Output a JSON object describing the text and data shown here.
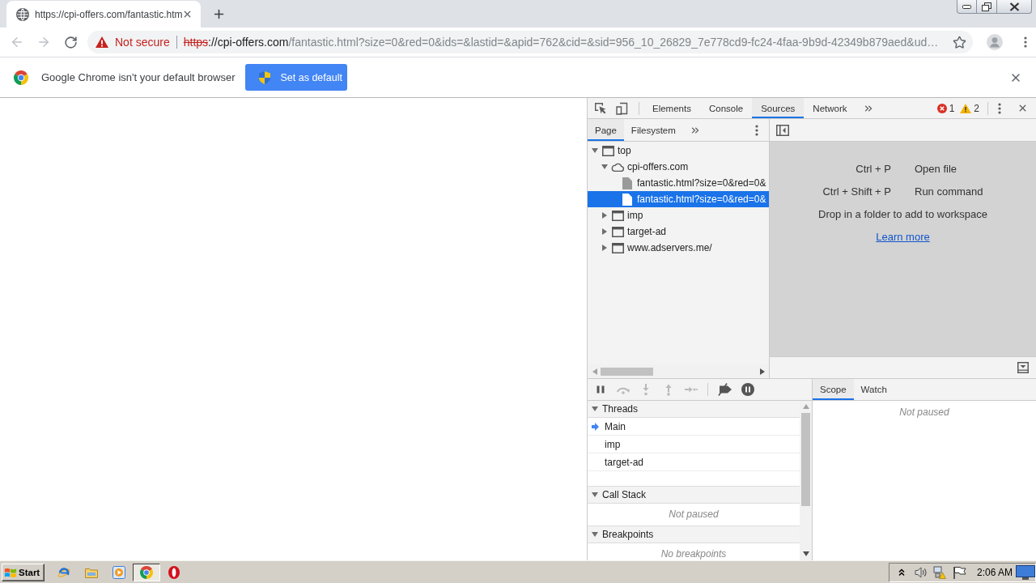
{
  "browser_tabs": [
    {
      "title": "https://cpi-offers.com/fantastic.htm",
      "selected": true
    }
  ],
  "nav_buttons": [
    {
      "kind": "back",
      "disabled": true
    },
    {
      "kind": "forward",
      "disabled": true
    },
    {
      "kind": "reload",
      "disabled": false
    }
  ],
  "address_bar": {
    "security_label": "Not secure",
    "url_scheme": "https",
    "url_host": "://cpi-offers.com",
    "url_path": "/fantastic.html?size=0&red=0&ids=&lastid=&apid=762&cid=&sid=956_10_26829_7e778cd9-fc24-4faa-9b9d-42349b879aed&ud…"
  },
  "infobar": {
    "message": "Google Chrome isn't your default browser",
    "button": "Set as default"
  },
  "devtools": {
    "tabs": [
      {
        "label": "Elements",
        "selected": false
      },
      {
        "label": "Console",
        "selected": false
      },
      {
        "label": "Sources",
        "selected": true
      },
      {
        "label": "Network",
        "selected": false
      }
    ],
    "error_count": "1",
    "warning_count": "2",
    "navigator_tabs": [
      {
        "label": "Page",
        "selected": true
      },
      {
        "label": "Filesystem",
        "selected": false
      }
    ],
    "tree": [
      {
        "label": "top",
        "kind": "frame",
        "expanded": true,
        "selected": false,
        "children": [
          {
            "label": "cpi-offers.com",
            "kind": "domain",
            "expanded": true,
            "selected": false,
            "children": [
              {
                "label": "fantastic.html?size=0&red=0&",
                "kind": "file",
                "selected": false
              },
              {
                "label": "fantastic.html?size=0&red=0&",
                "kind": "file",
                "selected": true
              }
            ]
          },
          {
            "label": "imp",
            "kind": "frame",
            "expanded": false,
            "selected": false
          },
          {
            "label": "target-ad",
            "kind": "frame",
            "expanded": false,
            "selected": false
          },
          {
            "label": "www.adservers.me/",
            "kind": "frame",
            "expanded": false,
            "selected": false
          }
        ]
      }
    ],
    "shortcuts": [
      {
        "keys": "Ctrl + P",
        "action": "Open file"
      },
      {
        "keys": "Ctrl + Shift + P",
        "action": "Run command"
      }
    ],
    "drop_hint": "Drop in a folder to add to workspace",
    "learn_more": "Learn more",
    "debug_controls": [
      {
        "kind": "pause",
        "disabled": false
      },
      {
        "kind": "step-over",
        "disabled": true
      },
      {
        "kind": "step-into",
        "disabled": true
      },
      {
        "kind": "step-out",
        "disabled": true
      },
      {
        "kind": "step",
        "disabled": true
      },
      {
        "kind": "deactivate-breakpoints",
        "disabled": false
      },
      {
        "kind": "pause-on-exceptions",
        "disabled": false
      }
    ],
    "sections": [
      {
        "title": "Threads",
        "kind": "threads",
        "expanded": true,
        "threads": [
          {
            "name": "Main",
            "selected": true
          },
          {
            "name": "imp",
            "selected": false
          },
          {
            "name": "target-ad",
            "selected": false
          }
        ]
      },
      {
        "title": "Call Stack",
        "kind": "message",
        "expanded": true,
        "message": "Not paused"
      },
      {
        "title": "Breakpoints",
        "kind": "message",
        "expanded": true,
        "message": "No breakpoints"
      }
    ],
    "scope_tabs": [
      {
        "label": "Scope",
        "selected": true
      },
      {
        "label": "Watch",
        "selected": false
      }
    ],
    "scope_message": "Not paused"
  },
  "taskbar": {
    "start": "Start",
    "apps": [
      {
        "kind": "e-logo",
        "selected": false
      },
      {
        "kind": "folder",
        "selected": false
      },
      {
        "kind": "play",
        "selected": false
      },
      {
        "kind": "browser-logo",
        "selected": true
      },
      {
        "kind": "o-logo",
        "selected": false
      }
    ],
    "clock": "2:06 AM"
  }
}
